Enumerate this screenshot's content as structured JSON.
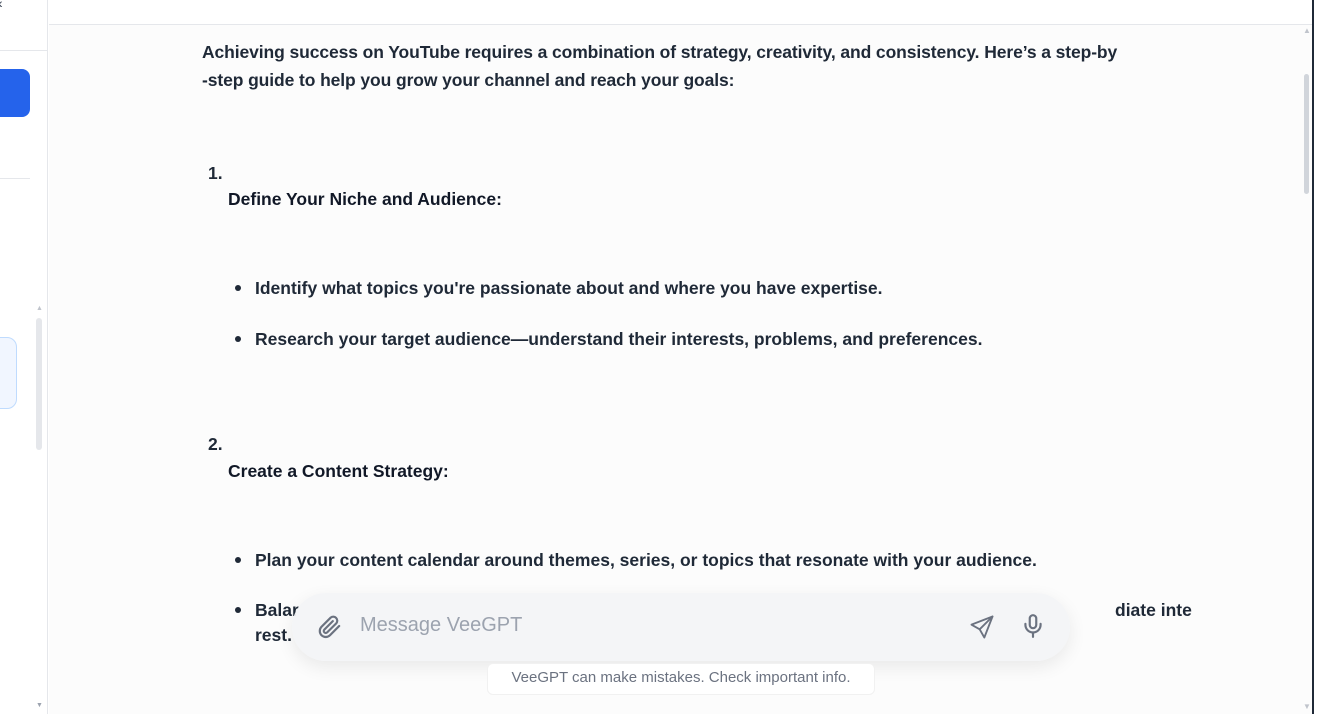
{
  "sidebar": {
    "back_glyph": "‹"
  },
  "message": {
    "intro": "Achieving success on YouTube requires a combination of strategy, creativity, and consistency. Here’s a step-by-step guide to help you grow your channel and reach your goals:",
    "intro_line1": "Achieving success on YouTube requires a combination of strategy, creativity, and consistency. Here’s a step-by",
    "intro_line2": "-step guide to help you grow your channel and reach your goals:",
    "sections": [
      {
        "number": "1.",
        "heading": "Define Your Niche and Audience:",
        "bullets": [
          "Identify what topics you're passionate about and where you have expertise.",
          "Research your target audience—understand their interests, problems, and preferences."
        ]
      },
      {
        "number": "2.",
        "heading": "Create a Content Strategy:",
        "bullets": [
          "Plan your content calendar around themes, series, or topics that resonate with your audience.",
          "Balar",
          "diate inte",
          "rest."
        ]
      }
    ]
  },
  "composer": {
    "placeholder": "Message VeeGPT",
    "attach_icon": "paperclip-icon",
    "send_icon": "send-icon",
    "mic_icon": "microphone-icon"
  },
  "disclaimer": "VeeGPT can make mistakes. Check important info.",
  "colors": {
    "accent": "#2563eb",
    "text": "#1f2937",
    "muted": "#6b7280"
  }
}
